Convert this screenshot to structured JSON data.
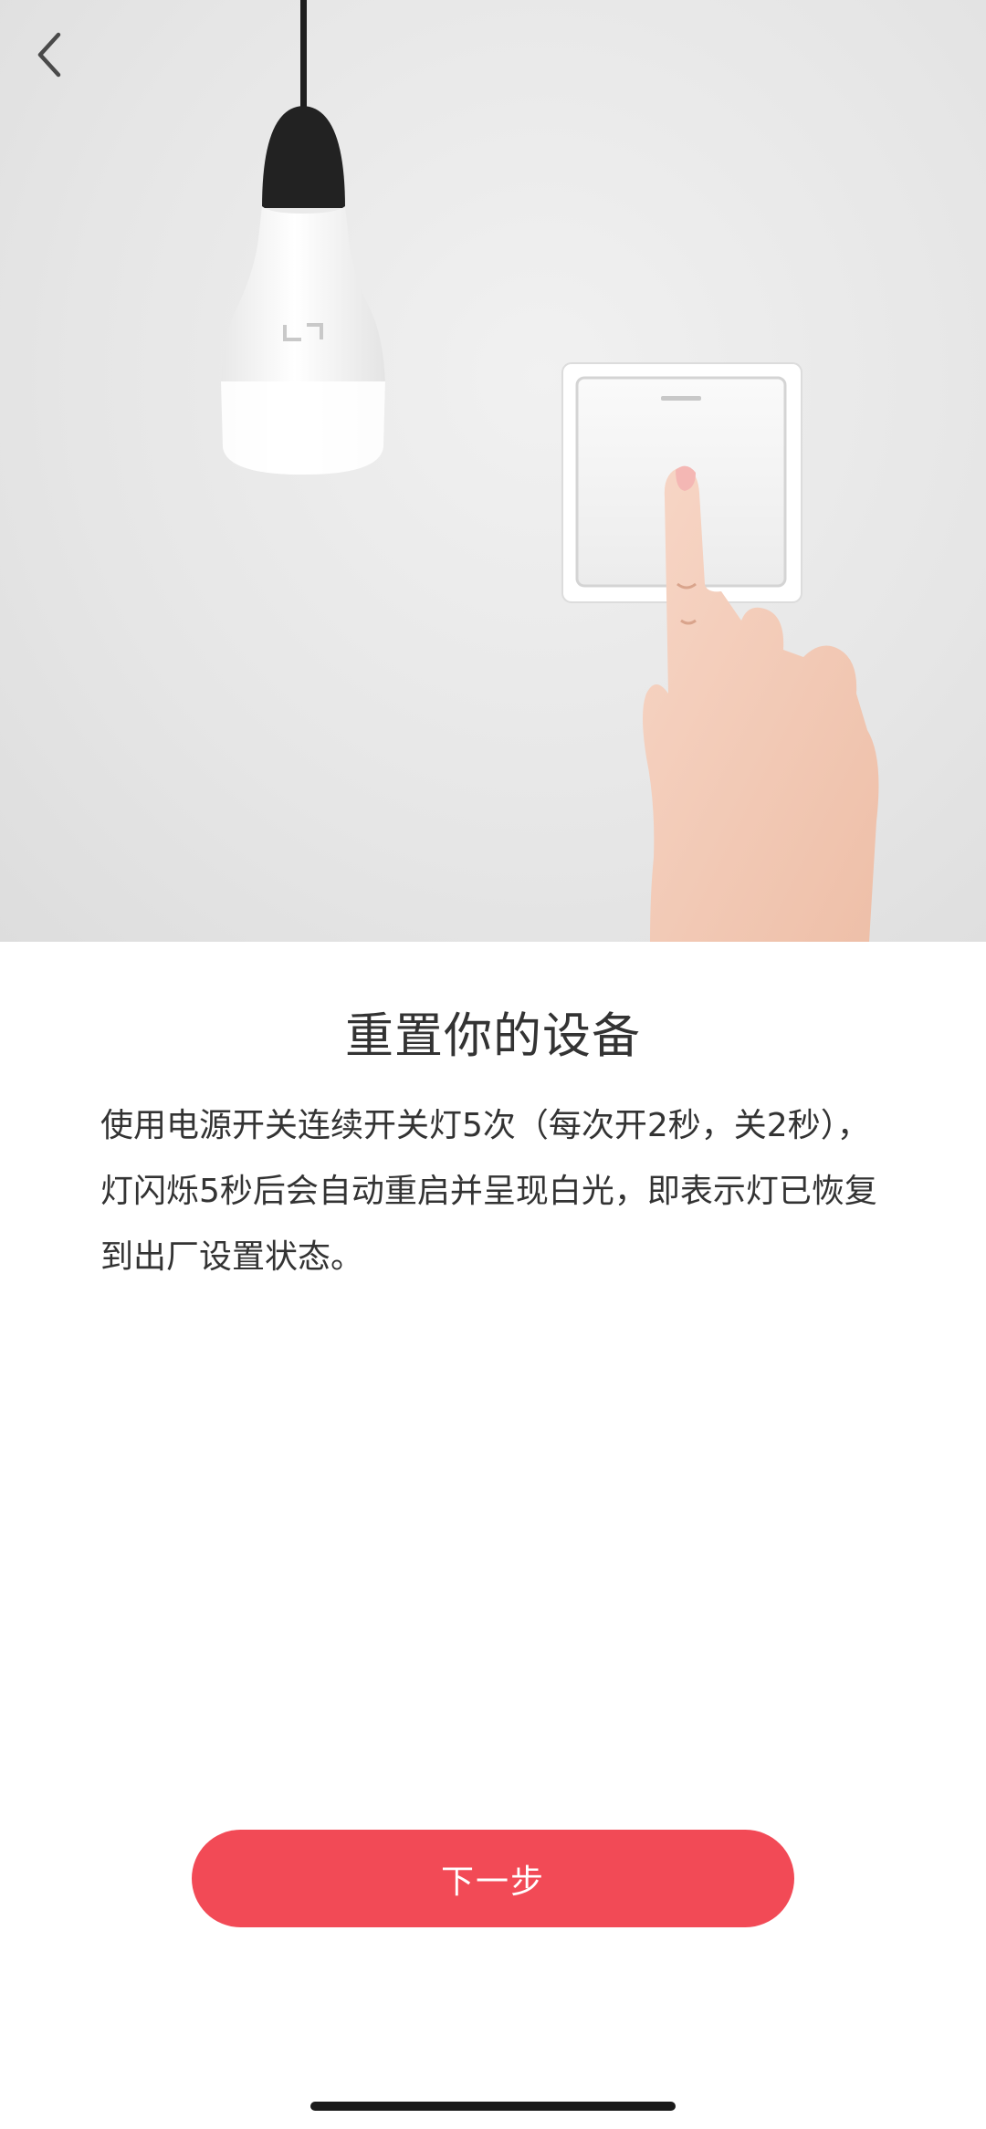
{
  "header": {
    "back_icon": "chevron-left-icon"
  },
  "illustration": {
    "bulb_icon": "light-bulb-icon",
    "switch_icon": "wall-switch-icon",
    "hand_icon": "pointing-hand-icon",
    "bulb_logo": "yeelight-logo"
  },
  "content": {
    "title": "重置你的设备",
    "description": "使用电源开关连续开关灯5次（每次开2秒，关2秒），灯闪烁5秒后会自动重启并呈现白光，即表示灯已恢复到出厂设置状态。"
  },
  "footer": {
    "next_label": "下一步"
  },
  "colors": {
    "accent": "#f24a56",
    "text": "#333333",
    "hero_bg": "#e6e6e6"
  }
}
